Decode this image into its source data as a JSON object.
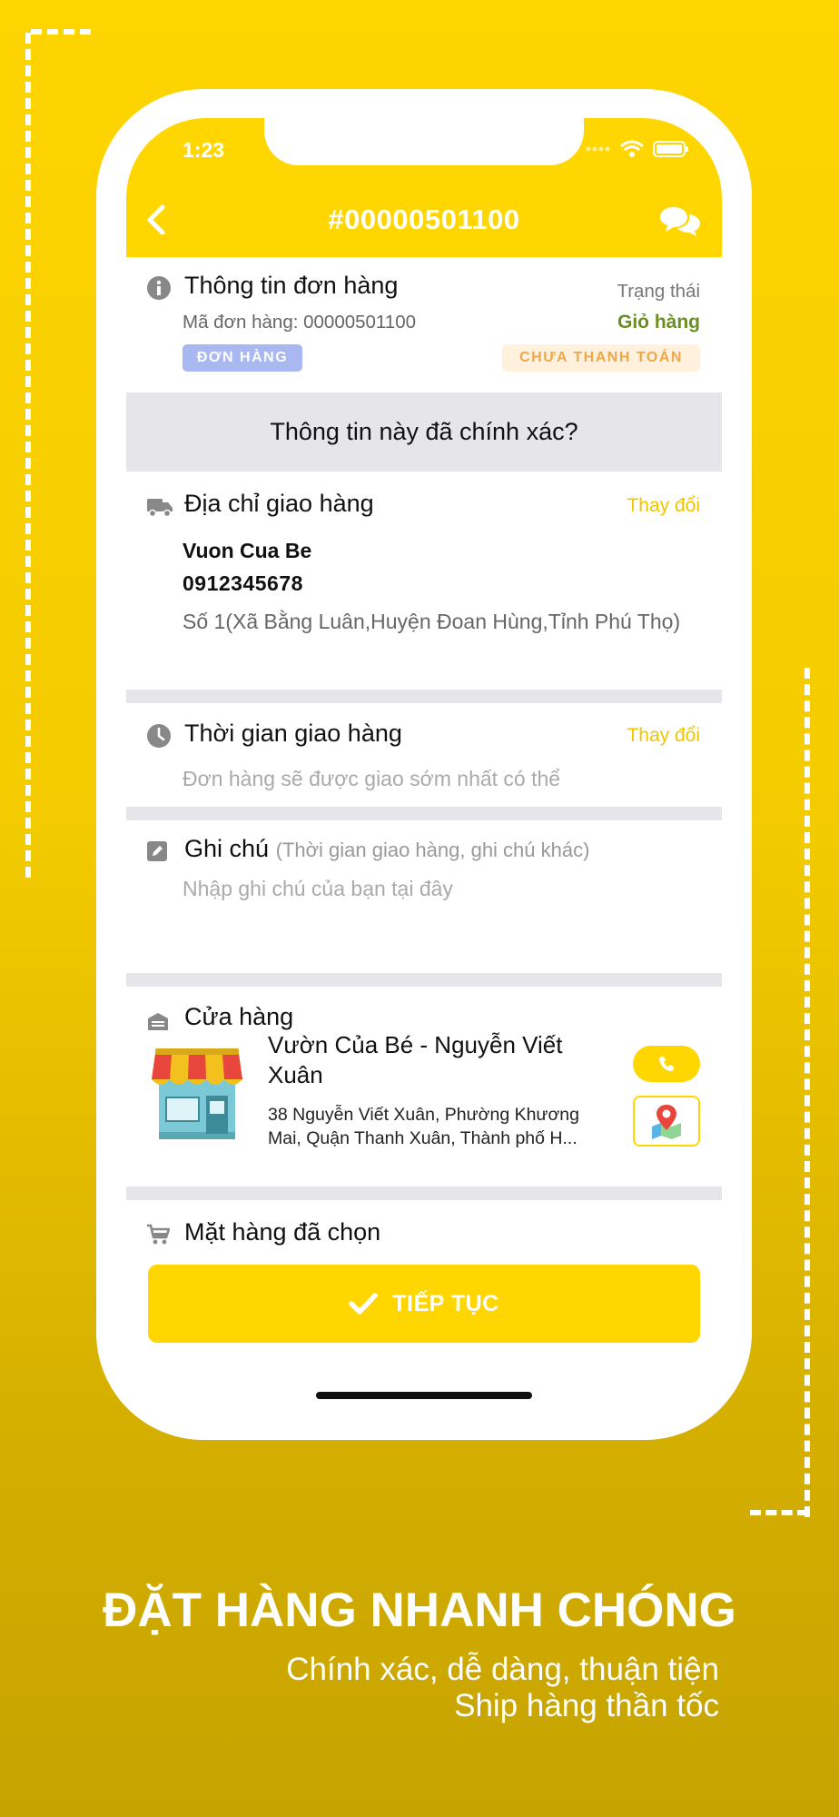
{
  "status_bar": {
    "time": "1:23"
  },
  "header": {
    "title": "#00000501100"
  },
  "order_info": {
    "title": "Thông tin đơn hàng",
    "order_code_label": "Mã đơn hàng: 00000501100",
    "status_label": "Trạng thái",
    "status_value": "Giỏ hàng",
    "order_badge": "ĐƠN HÀNG",
    "payment_badge": "CHƯA THANH TOÁN"
  },
  "confirm_prompt": "Thông tin này đã chính xác?",
  "address": {
    "title": "Địa chỉ giao hàng",
    "change_label": "Thay đổi",
    "name": "Vuon Cua Be",
    "phone": "0912345678",
    "line": "Số 1(Xã Bằng Luân,Huyện Đoan Hùng,Tỉnh Phú Thọ)"
  },
  "delivery_time": {
    "title": "Thời gian giao hàng",
    "change_label": "Thay đổi",
    "value": "Đơn hàng sẽ được giao sớm nhất có thể"
  },
  "note": {
    "title": "Ghi chú",
    "hint": "(Thời gian giao hàng, ghi chú khác)",
    "placeholder": "Nhập ghi chú của bạn tại đây"
  },
  "store": {
    "title": "Cửa hàng",
    "name": "Vườn Của Bé -  Nguyễn Viết Xuân",
    "address": "38 Nguyễn Viết Xuân, Phường Khương Mai, Quận Thanh Xuân, Thành phố H..."
  },
  "items_section": {
    "title": "Mặt hàng đã chọn"
  },
  "continue_button": {
    "label": "TIẾP TỤC"
  },
  "promo": {
    "headline": "ĐẶT HÀNG NHANH CHÓNG",
    "line1": "Chính xác, dễ dàng, thuận tiện",
    "line2": "Ship hàng thần tốc"
  },
  "colors": {
    "accent": "#ffd600",
    "status_green": "#6b8e23",
    "badge_blue": "#a9b8f0",
    "badge_orange_text": "#f0a64a"
  }
}
